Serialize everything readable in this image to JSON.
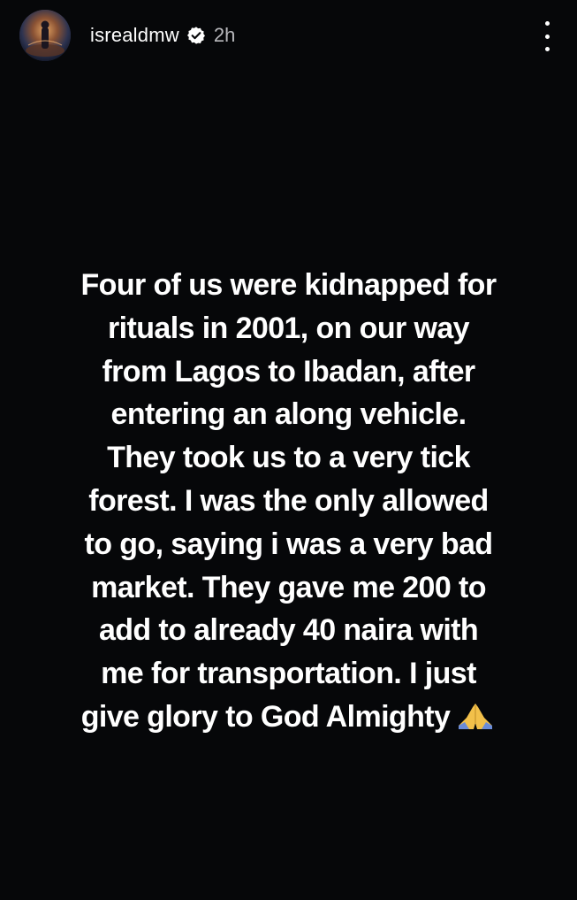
{
  "story": {
    "username": "isrealdmw",
    "time_ago": "2h",
    "verified": true,
    "message_lines": [
      "Four of us were kidnapped for",
      "rituals in 2001, on our way",
      "from Lagos to Ibadan, after",
      "entering an along vehicle.",
      "They took us to a very tick",
      "forest. I was the only allowed",
      "to go, saying i was a very bad",
      "market. They gave me 200 to",
      "add to already 40 naira with",
      "me for transportation. I just",
      "give glory to God Almighty"
    ],
    "trailing_emoji": "folded-hands-icon"
  },
  "colors": {
    "background": "#060709",
    "text": "#ffffff",
    "secondary_text": "#b8b8bc"
  }
}
